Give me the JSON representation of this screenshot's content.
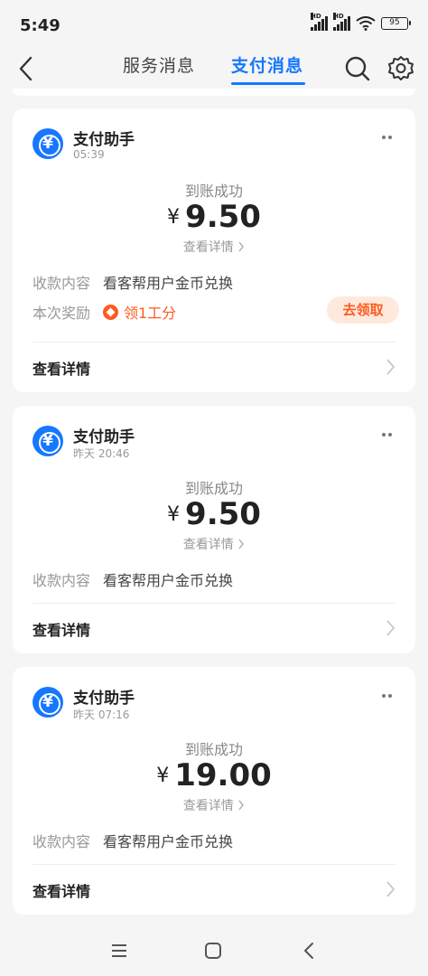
{
  "status_bar": {
    "time": "5:49",
    "battery": "95",
    "hd1": "HD",
    "hd2": "HD"
  },
  "nav": {
    "tabs": [
      "服务消息",
      "支付消息"
    ],
    "active_tab": 1
  },
  "messages": [
    {
      "sender": "支付助手",
      "time": "05:39",
      "status": "到账成功",
      "currency": "¥",
      "amount": "9.50",
      "detail_link": "查看详情",
      "field_label": "收款内容",
      "field_value": "看客帮用户金币兑换",
      "reward_label": "本次奖励",
      "reward_text": "领1工分",
      "claim_button": "去领取",
      "footer": "查看详情"
    },
    {
      "sender": "支付助手",
      "time": "昨天 20:46",
      "status": "到账成功",
      "currency": "¥",
      "amount": "9.50",
      "detail_link": "查看详情",
      "field_label": "收款内容",
      "field_value": "看客帮用户金币兑换",
      "footer": "查看详情"
    },
    {
      "sender": "支付助手",
      "time": "昨天 07:16",
      "status": "到账成功",
      "currency": "¥",
      "amount": "19.00",
      "detail_link": "查看详情",
      "field_label": "收款内容",
      "field_value": "看客帮用户金币兑换",
      "footer": "查看详情"
    }
  ],
  "colors": {
    "accent": "#1677ff",
    "reward": "#ff5a1f",
    "claim_bg": "#ffe9dc",
    "background": "#f5f5f5"
  },
  "icons": [
    "back-icon",
    "search-icon",
    "gear-icon",
    "more-icon",
    "yuan-logo-icon",
    "reward-icon",
    "chevron-right-icon",
    "menu-icon",
    "home-icon",
    "back-nav-icon"
  ]
}
